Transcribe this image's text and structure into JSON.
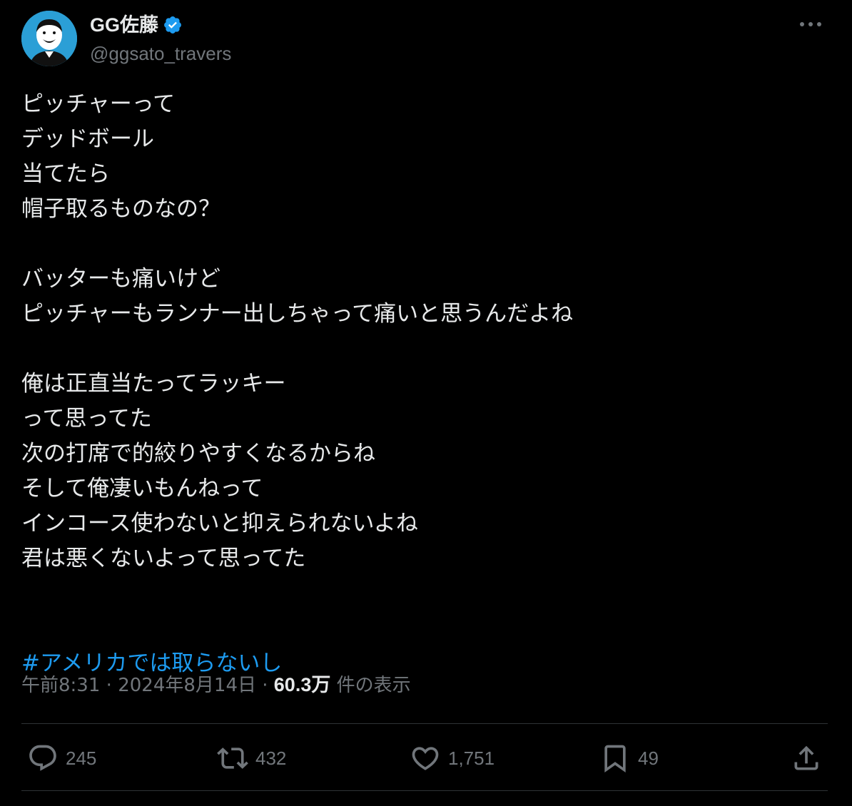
{
  "author": {
    "display_name": "GG佐藤",
    "handle": "@ggsato_travers",
    "verified": true
  },
  "tweet": {
    "lines": [
      "ピッチャーって",
      "デッドボール",
      "当てたら",
      "帽子取るものなの？",
      "",
      "バッターも痛いけど",
      "ピッチャーもランナー出しちゃって痛いと思うんだよね",
      "",
      "俺は正直当たってラッキー",
      "って思ってた",
      "次の打席で的絞りやすくなるからね",
      "そして俺凄いもんねって",
      "インコース使わないと抑えられないよね",
      "君は悪くないよって思ってた",
      ""
    ],
    "hashtag": "#アメリカでは取らないし"
  },
  "meta": {
    "time": "午前8:31",
    "separator": "·",
    "date": "2024年8月14日",
    "views_count": "60.3万",
    "views_label": "件の表示"
  },
  "actions": {
    "reply_count": "245",
    "retweet_count": "432",
    "like_count": "1,751",
    "bookmark_count": "49"
  },
  "colors": {
    "background": "#000000",
    "text": "#e7e9ea",
    "secondary": "#71767b",
    "accent": "#1d9bf0",
    "divider": "#2f3336"
  },
  "icons": [
    "verified-badge-icon",
    "more-icon",
    "reply-icon",
    "retweet-icon",
    "like-icon",
    "bookmark-icon",
    "share-icon"
  ]
}
